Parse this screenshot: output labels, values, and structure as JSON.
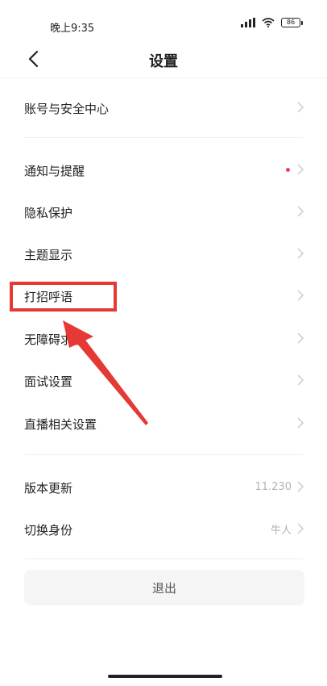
{
  "status_bar": {
    "time": "晚上9:35",
    "battery": "86"
  },
  "nav": {
    "title": "设置",
    "back_icon": "chevron-left-icon"
  },
  "settings": {
    "items": [
      {
        "label": "账号与安全中心",
        "value": "",
        "dot": false
      },
      {
        "label": "通知与提醒",
        "value": "",
        "dot": true
      },
      {
        "label": "隐私保护",
        "value": "",
        "dot": false
      },
      {
        "label": "主题显示",
        "value": "",
        "dot": false
      },
      {
        "label": "打招呼语",
        "value": "",
        "dot": false
      },
      {
        "label": "无障碍求职",
        "value": "",
        "dot": false
      },
      {
        "label": "面试设置",
        "value": "",
        "dot": false
      },
      {
        "label": "直播相关设置",
        "value": "",
        "dot": false
      },
      {
        "label": "版本更新",
        "value": "11.230",
        "dot": false
      },
      {
        "label": "切换身份",
        "value": "牛人",
        "dot": false
      }
    ]
  },
  "logout": {
    "label": "退出"
  },
  "colors": {
    "accent_red": "#e53935",
    "dot_red": "#e8474e",
    "chevron_gray": "#c8c8c8"
  }
}
